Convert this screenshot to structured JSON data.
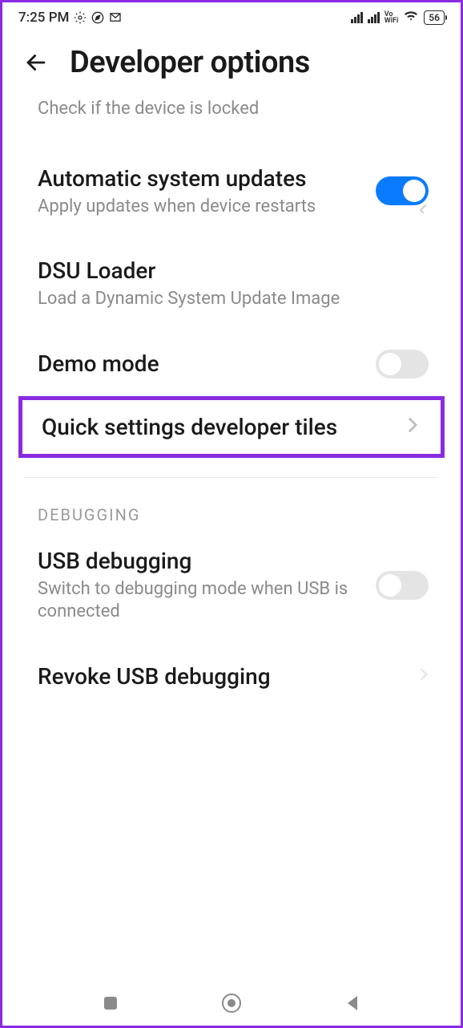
{
  "status": {
    "time": "7:25 PM",
    "battery": "56",
    "vowifi": "Vo\nWiFi"
  },
  "header": {
    "title": "Developer options"
  },
  "items": {
    "lock": {
      "sub": "Check if the device is locked"
    },
    "autoupdate": {
      "title": "Automatic system updates",
      "sub": "Apply updates when device restarts"
    },
    "dsu": {
      "title": "DSU Loader",
      "sub": "Load a Dynamic System Update Image"
    },
    "demo": {
      "title": "Demo mode"
    },
    "quicktiles": {
      "title": "Quick settings developer tiles"
    }
  },
  "section": {
    "debugging": "DEBUGGING"
  },
  "debug": {
    "usb": {
      "title": "USB debugging",
      "sub": "Switch to debugging mode when USB is connected"
    },
    "revoke": {
      "title": "Revoke USB debugging"
    }
  }
}
